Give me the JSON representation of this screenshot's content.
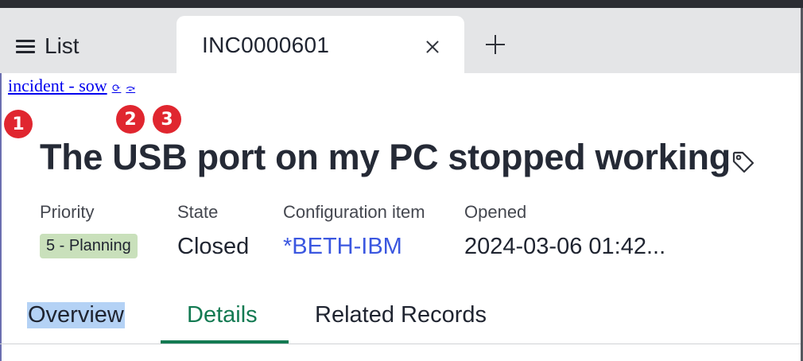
{
  "tabs": {
    "list_label": "List",
    "active_tab_label": "INC0000601"
  },
  "annotation_bar": {
    "link_label": "incident - sow",
    "link2_glyph": "⟳",
    "link3_glyph": "⤼"
  },
  "badges": [
    "1",
    "2",
    "3"
  ],
  "record": {
    "title": "The USB port on my PC stopped working",
    "fields": {
      "priority": {
        "label": "Priority",
        "value": "5 - Planning"
      },
      "state": {
        "label": "State",
        "value": "Closed"
      },
      "configuration_item": {
        "label": "Configuration item",
        "value": "*BETH-IBM"
      },
      "opened": {
        "label": "Opened",
        "value": "2024-03-06 01:42..."
      }
    }
  },
  "subtabs": {
    "overview": "Overview",
    "details": "Details",
    "related_records": "Related Records",
    "active": "Details"
  },
  "colors": {
    "active_tab_accent": "#137a52",
    "link_blue": "#3b57e0",
    "badge_red": "#e0262f",
    "priority_pill": "#c9e0bb"
  },
  "icons": [
    "list-icon",
    "close-icon",
    "plus-icon",
    "tag-icon"
  ]
}
